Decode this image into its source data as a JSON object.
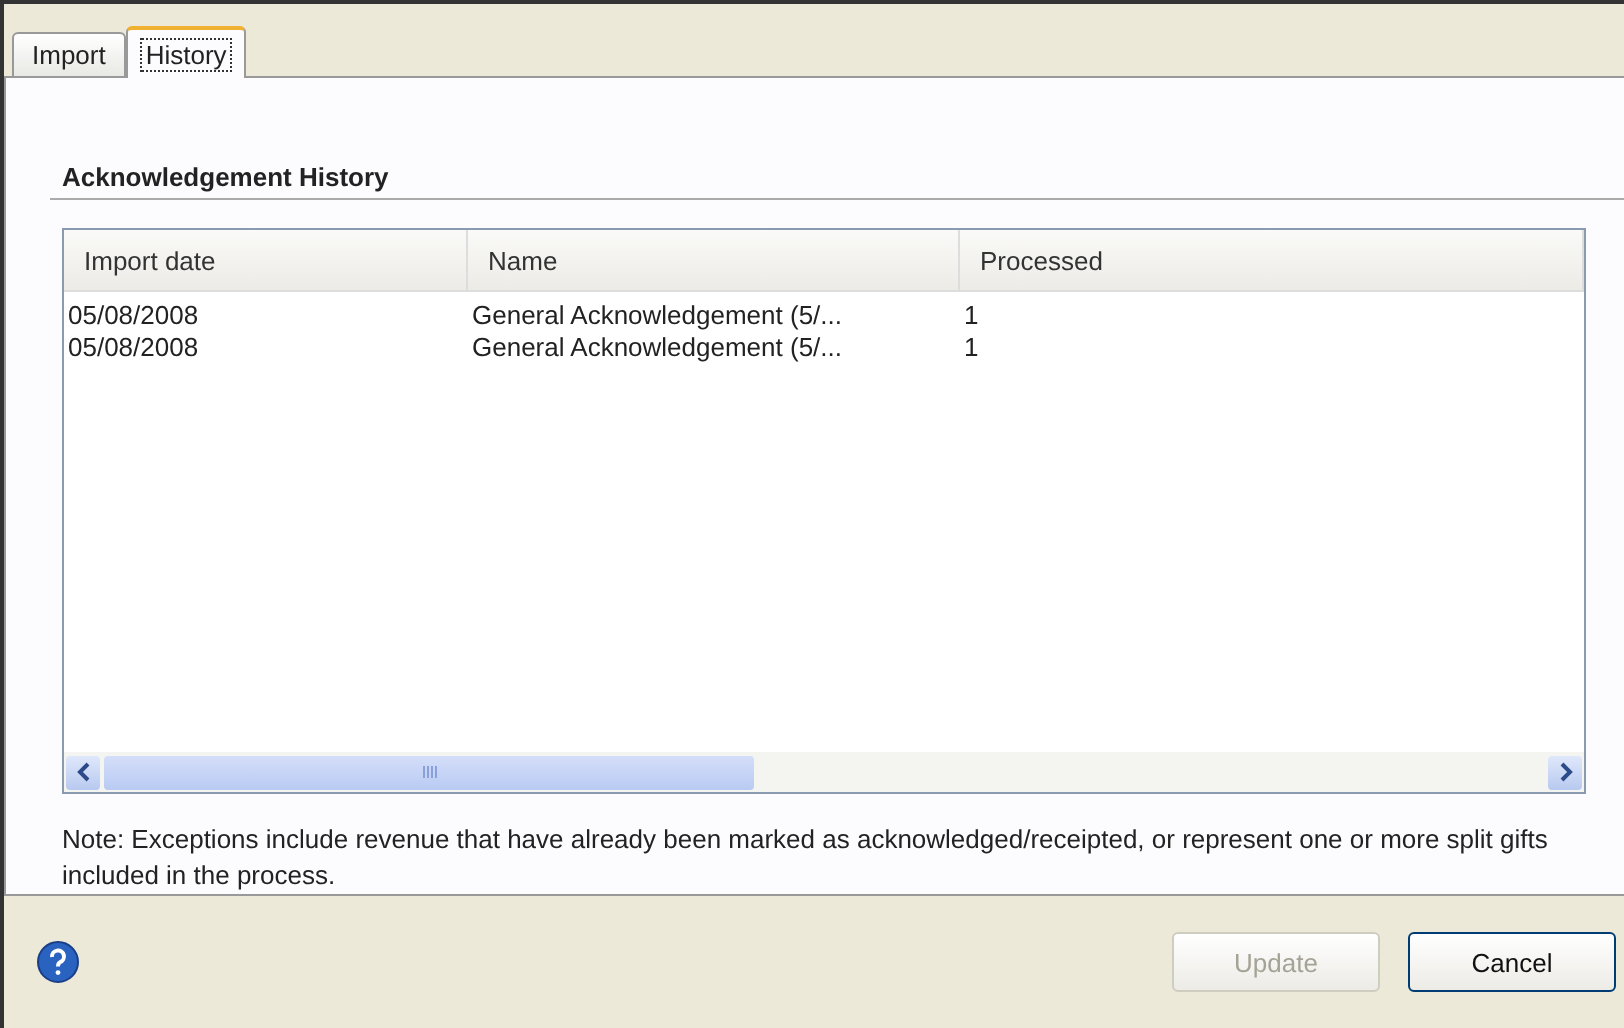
{
  "tabs": [
    {
      "label": "Import",
      "selected": false
    },
    {
      "label": "History",
      "selected": true
    }
  ],
  "section_title": "Acknowledgement History",
  "table": {
    "columns": [
      "Import date",
      "Name",
      "Processed"
    ],
    "rows": [
      [
        "05/08/2008",
        "General Acknowledgement (5/...",
        "1"
      ],
      [
        "05/08/2008",
        "General Acknowledgement (5/...",
        "1"
      ]
    ]
  },
  "note": "Note: Exceptions include revenue that have already been marked as acknowledged/receipted, or represent one or more split gifts included in the process.",
  "buttons": [
    {
      "label": "Update",
      "disabled": true
    },
    {
      "label": "Cancel",
      "disabled": false
    }
  ]
}
